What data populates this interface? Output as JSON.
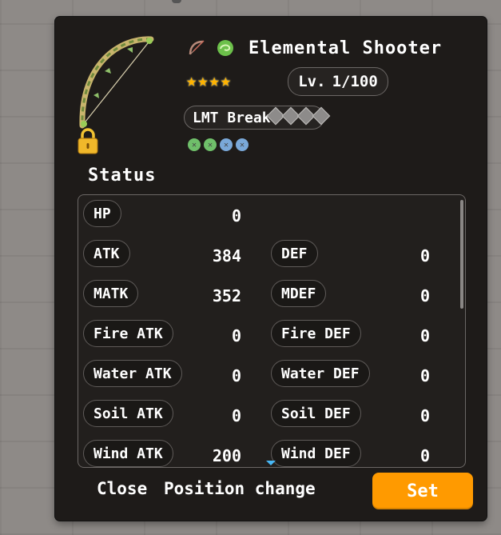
{
  "item": {
    "name": "Elemental Shooter",
    "level_label": "Lv.",
    "level_value": "1/100",
    "rarity_stars": 4,
    "lmt_label": "LMT Break",
    "lmt_diamonds": 4,
    "slots": [
      "green-x",
      "green-x",
      "blue-x",
      "blue-x"
    ],
    "weapon_icon": "bow-icon",
    "element_icon": "wind-swirl-icon",
    "locked": true
  },
  "status": {
    "heading": "Status",
    "rows": [
      {
        "left": {
          "label": "HP",
          "value": "0"
        }
      },
      {
        "left": {
          "label": "ATK",
          "value": "384"
        },
        "right": {
          "label": "DEF",
          "value": "0"
        }
      },
      {
        "left": {
          "label": "MATK",
          "value": "352"
        },
        "right": {
          "label": "MDEF",
          "value": "0"
        }
      },
      {
        "left": {
          "label": "Fire ATK",
          "value": "0"
        },
        "right": {
          "label": "Fire DEF",
          "value": "0"
        }
      },
      {
        "left": {
          "label": "Water ATK",
          "value": "0"
        },
        "right": {
          "label": "Water DEF",
          "value": "0"
        }
      },
      {
        "left": {
          "label": "Soil ATK",
          "value": "0"
        },
        "right": {
          "label": "Soil DEF",
          "value": "0"
        }
      },
      {
        "left": {
          "label": "Wind ATK",
          "value": "200"
        },
        "right": {
          "label": "Wind DEF",
          "value": "0"
        }
      }
    ]
  },
  "buttons": {
    "close": "Close",
    "position_change": "Position change",
    "set": "Set"
  },
  "colors": {
    "accent": "#ff9a00",
    "star": "#ffb300",
    "panel": "#1e1b19"
  }
}
